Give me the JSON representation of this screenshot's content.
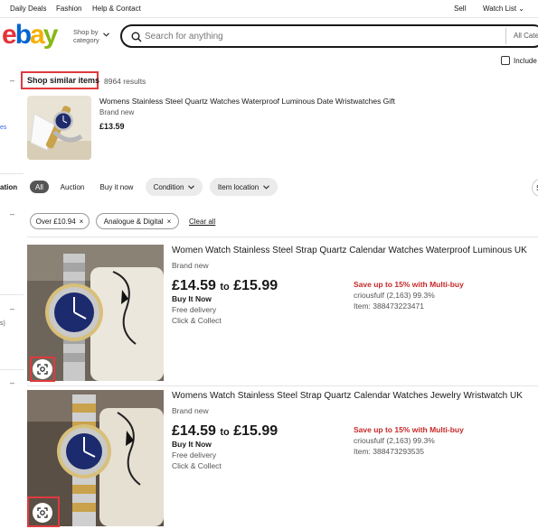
{
  "topnav": {
    "links": [
      "Daily Deals",
      "Fashion",
      "Help & Contact"
    ],
    "sell": "Sell",
    "watchlist": "Watch List"
  },
  "logo": {
    "letters": [
      "e",
      "b",
      "a",
      "y"
    ]
  },
  "header": {
    "shop_by_line1": "Shop by",
    "shop_by_line2": "category",
    "search_placeholder": "Search for anything",
    "category_select": "All Cate",
    "include_label": "Include"
  },
  "sidebar": {
    "fragments": [
      "es",
      "ation",
      "s)"
    ]
  },
  "similar": {
    "label": "Shop similar items",
    "count": "8964 results",
    "reference": {
      "title": "Womens Stainless Steel Quartz Watches Waterproof Luminous Date Wristwatches Gift",
      "condition": "Brand new",
      "price": "£13.59"
    }
  },
  "filters": {
    "tabs": [
      "All",
      "Auction",
      "Buy it now"
    ],
    "dropdowns": [
      "Condition",
      "Item location"
    ],
    "partial_right": "S",
    "chips": [
      "Over £10.94",
      "Analogue & Digital"
    ],
    "clear_all": "Clear all"
  },
  "listings": [
    {
      "title": "Women Watch Stainless Steel Strap Quartz Calendar Watches Waterproof Luminous UK",
      "condition": "Brand new",
      "price_low": "£14.59",
      "price_to": "to",
      "price_high": "£15.99",
      "format": "Buy It Now",
      "delivery": "Free delivery",
      "collect": "Click & Collect",
      "promo": "Save up to 15% with Multi-buy",
      "seller": "criousfulf (2,163) 99.3%",
      "item_no": "Item: 388473223471"
    },
    {
      "title": "Womens Watch Stainless Steel Strap Quartz Calendar Watches Jewelry Wristwatch UK",
      "condition": "Brand new",
      "price_low": "£14.59",
      "price_to": "to",
      "price_high": "£15.99",
      "format": "Buy It Now",
      "delivery": "Free delivery",
      "collect": "Click & Collect",
      "promo": "Save up to 15% with Multi-buy",
      "seller": "criousfulf (2,163) 99.3%",
      "item_no": "Item: 388473293535"
    }
  ],
  "colors": {
    "highlight_box": "#e03a3e",
    "promo_text": "#c62828",
    "pill_active": "#555555",
    "pill_inactive": "#ebebeb"
  }
}
